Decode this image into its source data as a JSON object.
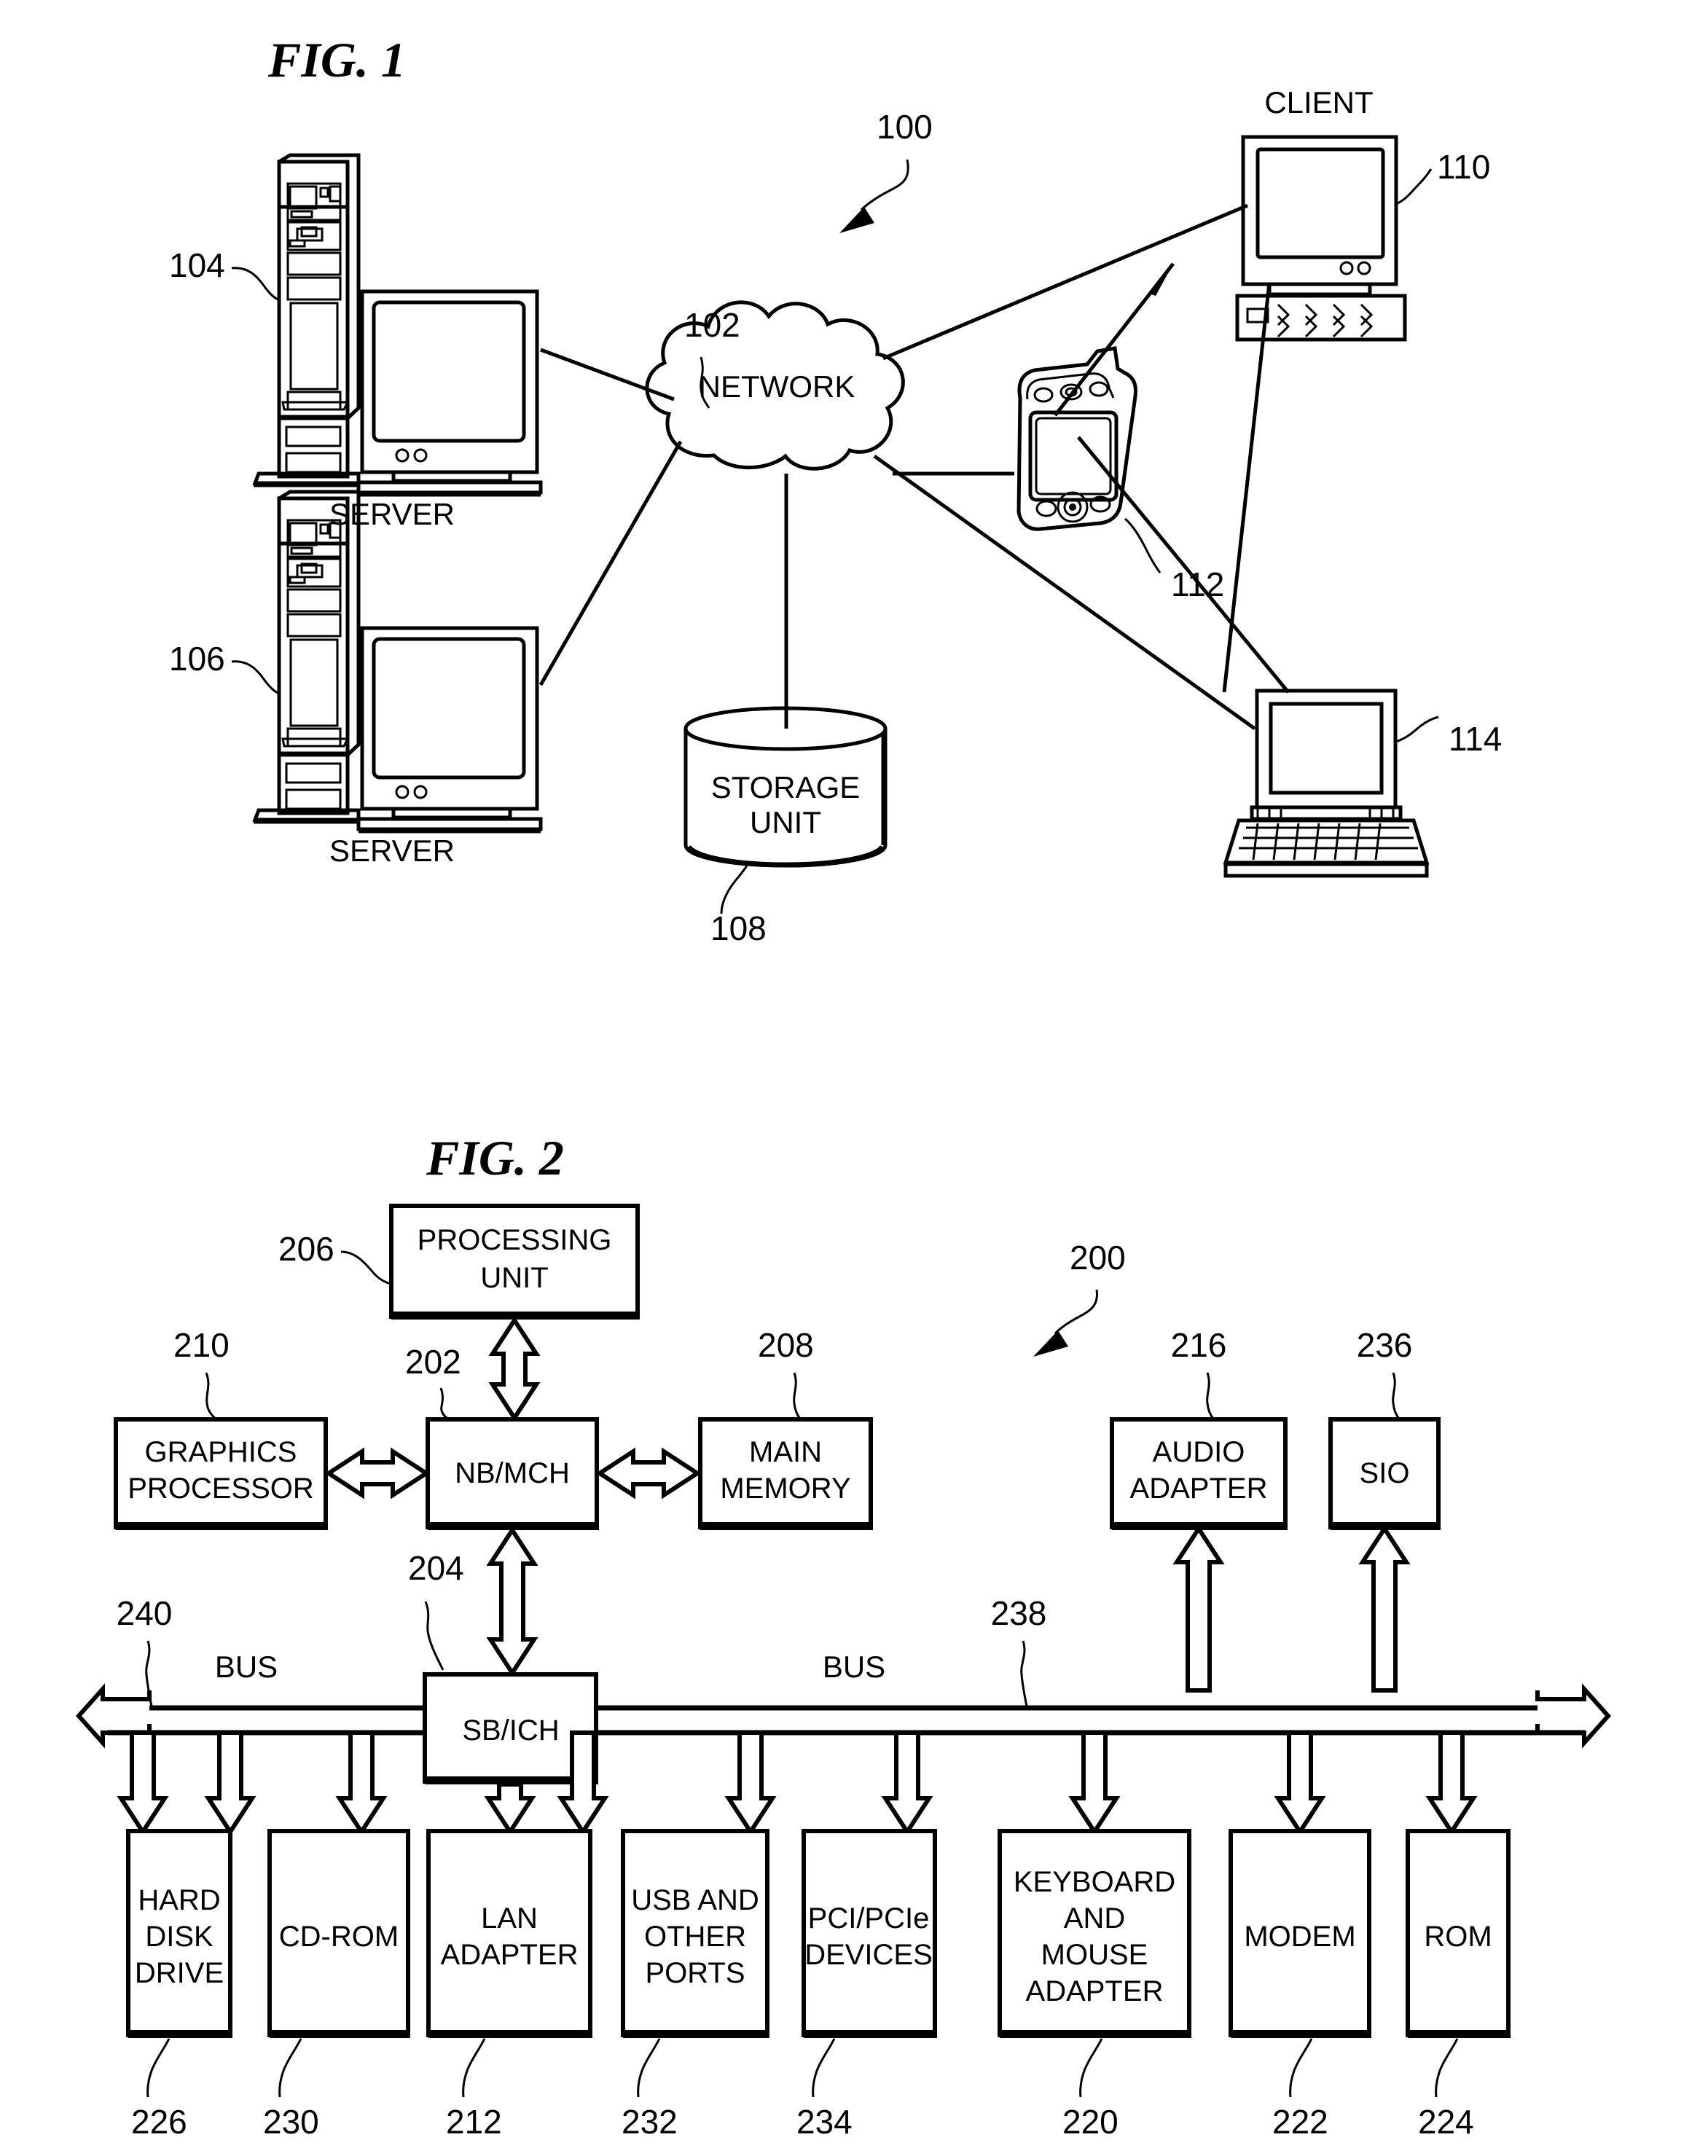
{
  "figures": [
    {
      "id": "fig1",
      "title": "FIG. 1",
      "system_ref": "100",
      "nodes": {
        "network": {
          "label": "NETWORK",
          "ref": "102"
        },
        "server_top": {
          "label": "SERVER",
          "ref": "104"
        },
        "server_bottom": {
          "label": "SERVER",
          "ref": "106"
        },
        "storage": {
          "label": "STORAGE UNIT",
          "label_line1": "STORAGE",
          "label_line2": "UNIT",
          "ref": "108"
        },
        "client_desktop": {
          "label": "CLIENT",
          "ref": "110"
        },
        "client_pda": {
          "label": "",
          "ref": "112"
        },
        "client_laptop": {
          "label": "",
          "ref": "114"
        }
      }
    },
    {
      "id": "fig2",
      "title": "FIG. 2",
      "system_ref": "200",
      "nodes": {
        "processing_unit": {
          "line1": "PROCESSING",
          "line2": "UNIT",
          "ref": "206"
        },
        "nb_mch": {
          "line1": "NB/MCH",
          "line2": "",
          "ref": "202"
        },
        "sb_ich": {
          "line1": "SB/ICH",
          "line2": "",
          "ref": "204"
        },
        "graphics_processor": {
          "line1": "GRAPHICS",
          "line2": "PROCESSOR",
          "ref": "210"
        },
        "main_memory": {
          "line1": "MAIN",
          "line2": "MEMORY",
          "ref": "208"
        },
        "audio_adapter": {
          "line1": "AUDIO",
          "line2": "ADAPTER",
          "ref": "216"
        },
        "sio": {
          "line1": "SIO",
          "line2": "",
          "ref": "236"
        }
      },
      "buses": [
        {
          "label": "BUS",
          "ref": "240"
        },
        {
          "label": "BUS",
          "ref": "238"
        }
      ],
      "peripherals": [
        {
          "lines": [
            "HARD",
            "DISK",
            "DRIVE"
          ],
          "ref": "226"
        },
        {
          "lines": [
            "CD-ROM"
          ],
          "ref": "230"
        },
        {
          "lines": [
            "LAN",
            "ADAPTER"
          ],
          "ref": "212"
        },
        {
          "lines": [
            "USB AND",
            "OTHER",
            "PORTS"
          ],
          "ref": "232"
        },
        {
          "lines": [
            "PCI/PCIe",
            "DEVICES"
          ],
          "ref": "234"
        },
        {
          "lines": [
            "KEYBOARD",
            "AND",
            "MOUSE",
            "ADAPTER"
          ],
          "ref": "220"
        },
        {
          "lines": [
            "MODEM"
          ],
          "ref": "222"
        },
        {
          "lines": [
            "ROM"
          ],
          "ref": "224"
        }
      ]
    }
  ],
  "colors": {
    "ink": "#000000",
    "paper": "#ffffff"
  }
}
